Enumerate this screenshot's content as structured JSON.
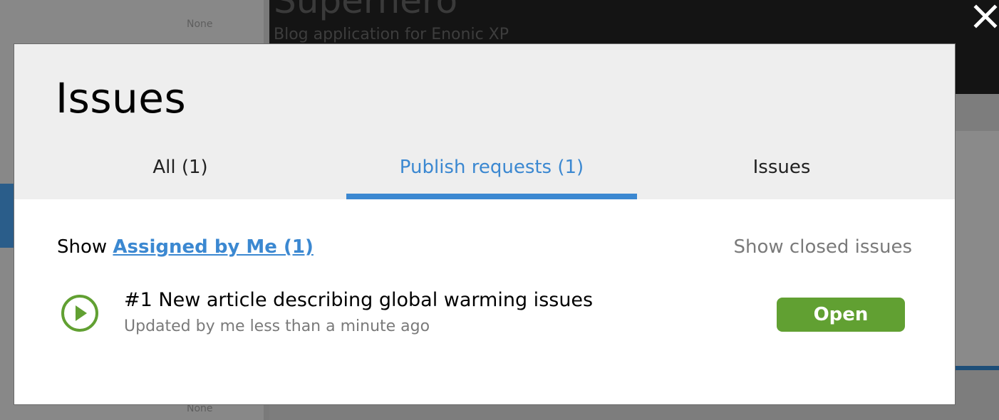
{
  "background": {
    "app_title": "Superhero",
    "app_subtitle": "Blog application for Enonic XP",
    "faint_top": "None",
    "faint_bottom": "None"
  },
  "close_icon": "close-icon",
  "modal": {
    "title": "Issues",
    "tabs": [
      {
        "label": "All (1)",
        "active": false
      },
      {
        "label": "Publish requests (1)",
        "active": true
      },
      {
        "label": "Issues",
        "active": false
      }
    ],
    "filter": {
      "prefix": "Show",
      "link_label": "Assigned by Me (1)",
      "closed_toggle": "Show closed issues"
    },
    "issues": [
      {
        "icon": "play-circle-icon",
        "title": "#1 New article describing global warming issues",
        "meta": "Updated by me less than a minute ago",
        "status": "Open"
      }
    ]
  },
  "colors": {
    "accent_blue": "#3b88d1",
    "status_green": "#61a032",
    "header_bg": "#eeeeee"
  }
}
